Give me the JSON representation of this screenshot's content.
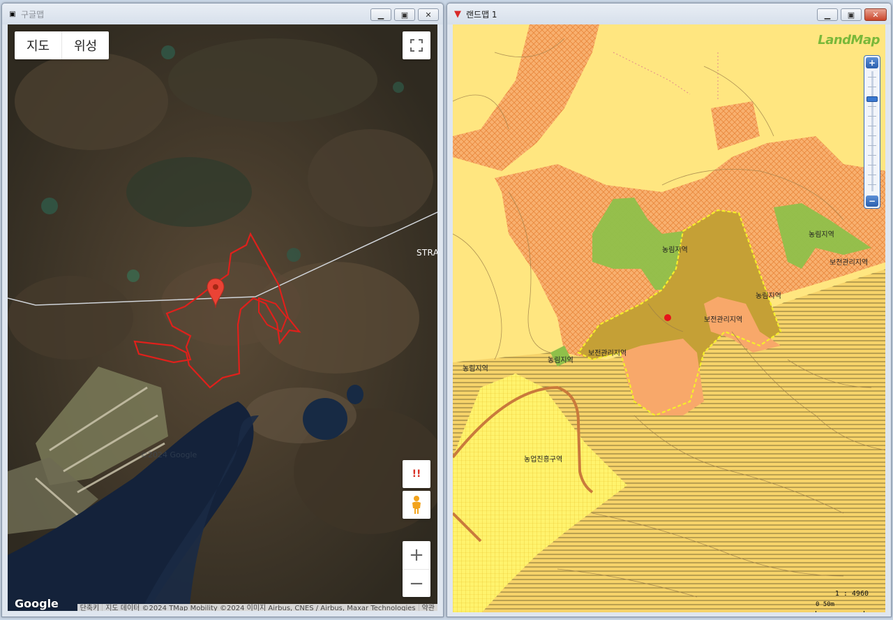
{
  "left_window": {
    "title": "구글맵",
    "map_type_buttons": [
      "지도",
      "위성"
    ],
    "label_strat": "STRAT",
    "google_logo": "Google",
    "attribution": [
      "단축키",
      "지도 데이터 ©2024 TMap Mobility ©2024 이미지 Airbus, CNES / Airbus, Maxar Technologies",
      "약관"
    ],
    "warning_glyph": "!!",
    "zoom_in": "+",
    "zoom_out": "−"
  },
  "right_window": {
    "title": "랜드맵 1",
    "logo": "LandMap",
    "labels": {
      "forest_1": "농림지역",
      "forest_2": "농림지역",
      "forest_3": "농림지역",
      "forest_4": "농림지역",
      "forest_5": "농림지역",
      "conserve_1": "보전관리지역",
      "conserve_2": "보전관리지역",
      "conserve_3": "보전관리지역",
      "agri_promo": "농업진흥구역"
    },
    "scale_text": "1 : 4960",
    "scale_bar_text": "0   50m",
    "zoom_in": "+",
    "zoom_out": "−"
  },
  "colors": {
    "parcel_outline": "#e0201b",
    "forest_zone": "#ffe680",
    "management_zone": "#f8b06f",
    "conservation_zone": "#8fc04a",
    "agri_zone": "#fff36d",
    "selected_parcel": "#c5a036"
  },
  "window_buttons": [
    "minimize-icon",
    "restore-icon",
    "close-icon"
  ]
}
